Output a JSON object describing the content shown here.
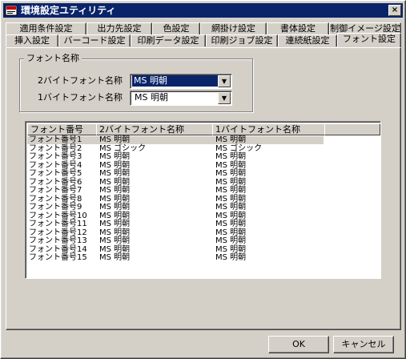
{
  "window": {
    "title": "環境設定ユティリティ",
    "close_label": "×"
  },
  "tabs_back": [
    "適用条件設定",
    "出力先設定",
    "色設定",
    "網掛け設定",
    "書体設定",
    "制御イメージ設定"
  ],
  "tabs_front": [
    "挿入設定",
    "バーコード設定",
    "印刷データ設定",
    "印刷ジョブ設定",
    "連続紙設定",
    "フォント設定"
  ],
  "active_tab": "フォント設定",
  "font_group": {
    "label": "フォント名称",
    "double_byte_label": "2バイトフォント名称",
    "double_byte_value": "MS 明朝",
    "single_byte_label": "1バイトフォント名称",
    "single_byte_value": "MS 明朝"
  },
  "list": {
    "columns": [
      "フォント番号",
      "2バイトフォント名称",
      "1バイトフォント名称"
    ],
    "rows": [
      [
        "フォント番号1",
        "MS 明朝",
        "MS 明朝"
      ],
      [
        "フォント番号2",
        "MS ゴシック",
        "MS ゴシック"
      ],
      [
        "フォント番号3",
        "MS 明朝",
        "MS 明朝"
      ],
      [
        "フォント番号4",
        "MS 明朝",
        "MS 明朝"
      ],
      [
        "フォント番号5",
        "MS 明朝",
        "MS 明朝"
      ],
      [
        "フォント番号6",
        "MS 明朝",
        "MS 明朝"
      ],
      [
        "フォント番号7",
        "MS 明朝",
        "MS 明朝"
      ],
      [
        "フォント番号8",
        "MS 明朝",
        "MS 明朝"
      ],
      [
        "フォント番号9",
        "MS 明朝",
        "MS 明朝"
      ],
      [
        "フォント番号10",
        "MS 明朝",
        "MS 明朝"
      ],
      [
        "フォント番号11",
        "MS 明朝",
        "MS 明朝"
      ],
      [
        "フォント番号12",
        "MS 明朝",
        "MS 明朝"
      ],
      [
        "フォント番号13",
        "MS 明朝",
        "MS 明朝"
      ],
      [
        "フォント番号14",
        "MS 明朝",
        "MS 明朝"
      ],
      [
        "フォント番号15",
        "MS 明朝",
        "MS 明朝"
      ]
    ],
    "selected_row": 0
  },
  "buttons": {
    "ok": "OK",
    "cancel": "キャンセル"
  },
  "colors": {
    "face": "#d4d0c8",
    "titlebar": "#0a246a",
    "selection": "#0a246a"
  },
  "icons": {
    "app": "app-icon",
    "close": "close-icon",
    "dropdown": "chevron-down-icon"
  }
}
